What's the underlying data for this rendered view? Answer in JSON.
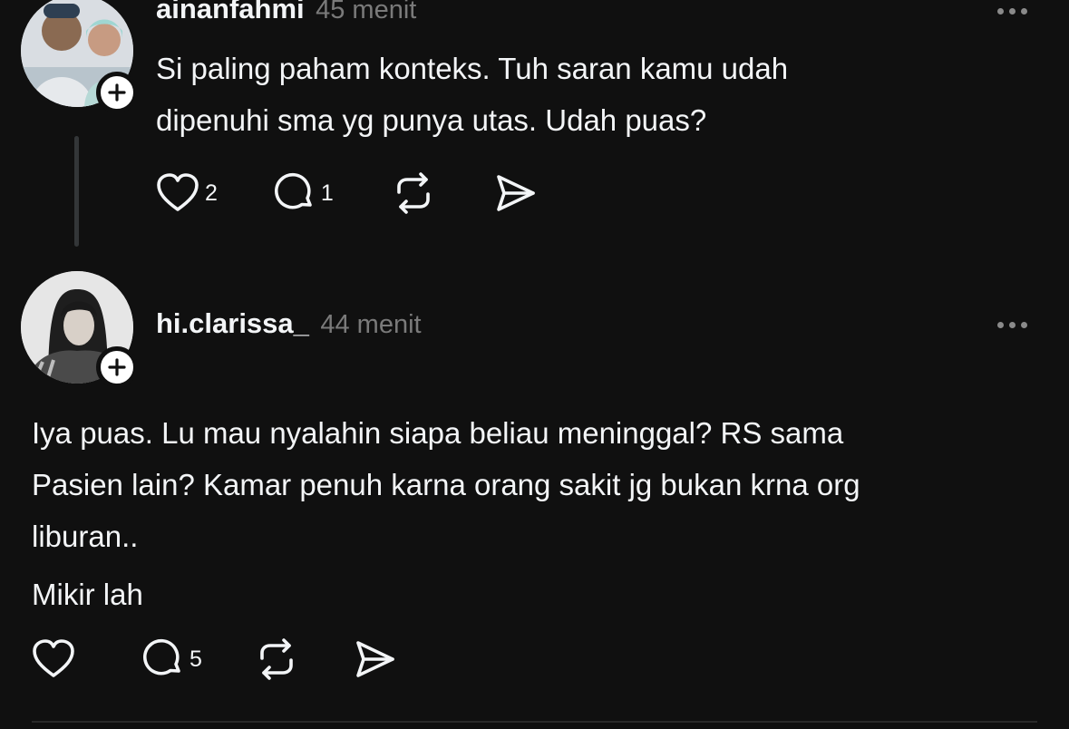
{
  "posts": [
    {
      "username": "ainanfahmi",
      "time": "45 menit",
      "text": [
        "Si paling paham konteks. Tuh saran kamu udah",
        "dipenuhi sma yg punya utas. Udah puas?"
      ],
      "likes": "2",
      "replies": "1"
    },
    {
      "username": "hi.clarissa_",
      "time": "44 menit",
      "text": [
        "Iya puas. Lu mau nyalahin siapa beliau meninggal? RS sama",
        "Pasien lain? Kamar penuh karna orang sakit jg bukan krna org",
        "liburan..",
        "Mikir lah"
      ],
      "likes": "",
      "replies": "5"
    }
  ],
  "icons": {
    "like": "heart-icon",
    "reply": "comment-icon",
    "repost": "repost-icon",
    "share": "send-icon",
    "more": "more-icon",
    "follow": "plus-icon"
  },
  "colors": {
    "background": "#101010",
    "text": "#f3f5f7",
    "muted": "#7a7a7a"
  }
}
